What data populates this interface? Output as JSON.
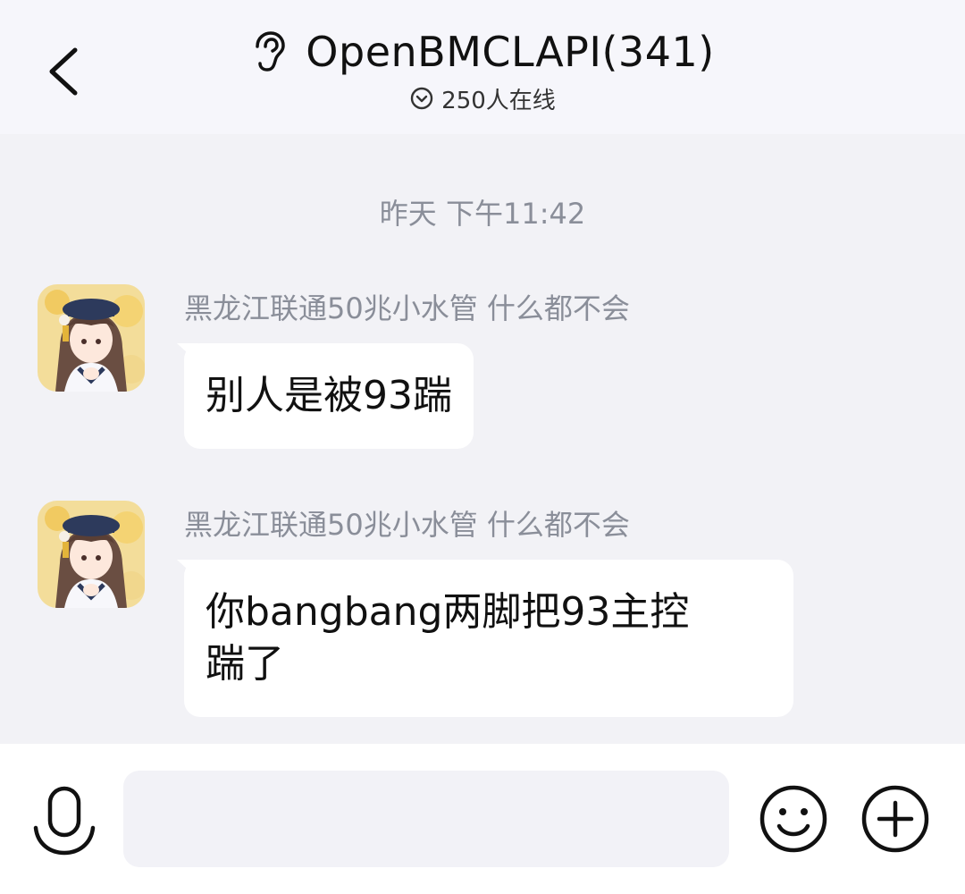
{
  "header": {
    "back_icon": "chevron-left-icon",
    "ear_icon": "ear-icon",
    "title": "OpenBMCLAPI(341)",
    "online_icon": "chevron-down-circle-icon",
    "online_text": "250人在线"
  },
  "chat": {
    "timestamp": "昨天 下午11:42",
    "messages": [
      {
        "sender": "黑龙江联通50兆小水管 什么都不会",
        "text": "别人是被93踹"
      },
      {
        "sender": "黑龙江联通50兆小水管 什么都不会",
        "text_line1": "你bangbang两脚把93主控",
        "text_line2": "踹了"
      }
    ]
  },
  "input_bar": {
    "voice_icon": "microphone-icon",
    "input_value": "",
    "emoji_icon": "smiley-icon",
    "plus_icon": "plus-circle-icon"
  },
  "colors": {
    "header_bg": "#f6f6fb",
    "chat_bg": "#f2f2f6",
    "bubble_bg": "#ffffff",
    "meta_text": "#8a8e99"
  }
}
